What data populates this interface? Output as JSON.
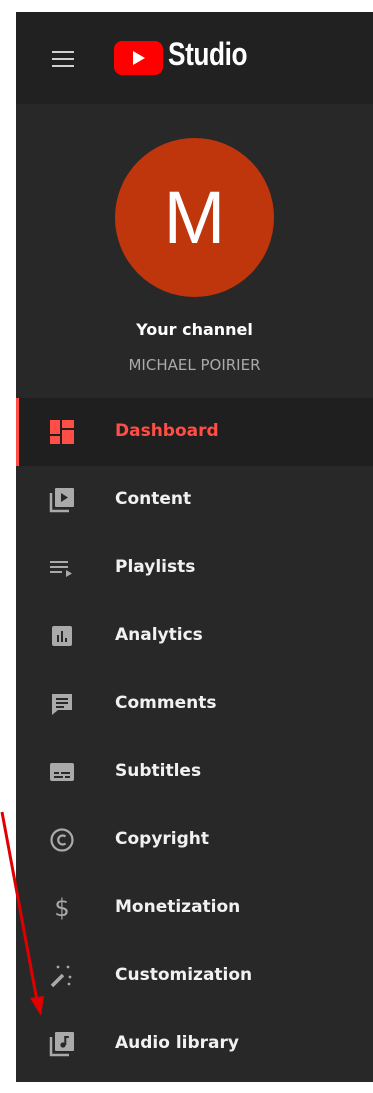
{
  "app": {
    "title": "Studio",
    "brand_color": "#ff0000"
  },
  "channel": {
    "avatar_letter": "M",
    "avatar_color": "#bf360c",
    "title": "Your channel",
    "name": "MICHAEL POIRIER"
  },
  "nav": {
    "active_color": "#ff4e45",
    "items": [
      {
        "label": "Dashboard",
        "icon": "dashboard-icon",
        "active": true
      },
      {
        "label": "Content",
        "icon": "content-icon"
      },
      {
        "label": "Playlists",
        "icon": "playlists-icon"
      },
      {
        "label": "Analytics",
        "icon": "analytics-icon"
      },
      {
        "label": "Comments",
        "icon": "comments-icon"
      },
      {
        "label": "Subtitles",
        "icon": "subtitles-icon"
      },
      {
        "label": "Copyright",
        "icon": "copyright-icon"
      },
      {
        "label": "Monetization",
        "icon": "monetization-icon"
      },
      {
        "label": "Customization",
        "icon": "customization-icon"
      },
      {
        "label": "Audio library",
        "icon": "audio-library-icon"
      }
    ]
  },
  "annotation": {
    "arrow_color": "#e00000"
  }
}
